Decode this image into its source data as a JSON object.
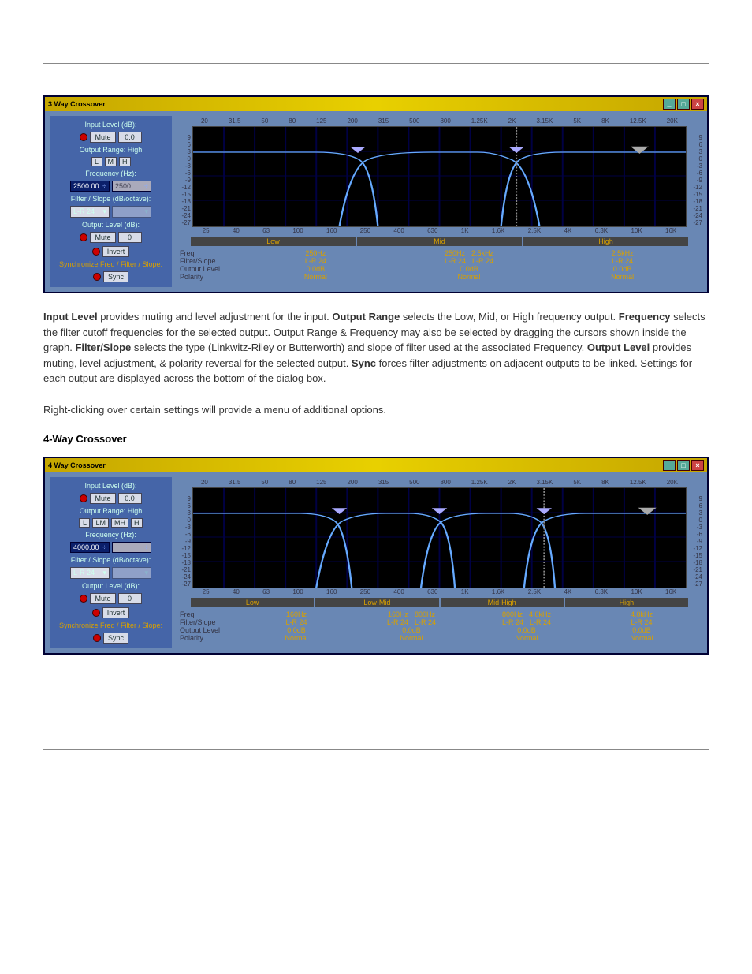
{
  "win3": {
    "title": "3 Way Crossover",
    "sidebar": {
      "input_label": "Input Level (dB):",
      "mute": "Mute",
      "val": "0.0",
      "range_label": "Output Range: High",
      "btns": [
        "L",
        "M",
        "H"
      ],
      "freq_label": "Frequency (Hz):",
      "freq_val": "2500.00",
      "freq_inact": "2500",
      "filt_label": "Filter / Slope (dB/octave):",
      "filt_val": "L-R 24",
      "out_label": "Output Level (dB):",
      "out_mute": "Mute",
      "out_val": "0",
      "invert": "Invert",
      "sync_label": "Synchronize Freq / Filter / Slope:",
      "sync": "Sync"
    },
    "ytop": [
      "20",
      "31.5",
      "50",
      "80",
      "125",
      "200",
      "315",
      "500",
      "800",
      "1.25K",
      "2K",
      "3.15K",
      "5K",
      "8K",
      "12.5K",
      "20K"
    ],
    "ybot": [
      "25",
      "40",
      "63",
      "100",
      "160",
      "250",
      "400",
      "630",
      "1K",
      "1.6K",
      "2.5K",
      "4K",
      "6.3K",
      "10K",
      "16K"
    ],
    "yl": [
      "9",
      "6",
      "3",
      "0",
      "-3",
      "-6",
      "-9",
      "-12",
      "-15",
      "-18",
      "-21",
      "-24",
      "-27"
    ],
    "yr": [
      "9",
      "6",
      "3",
      "0",
      "-3",
      "-6",
      "-9",
      "-12",
      "-15",
      "-18",
      "-21",
      "-24",
      "-27"
    ],
    "bands": [
      "Low",
      "Mid",
      "High"
    ],
    "summary": {
      "labels": [
        "Freq",
        "Filter/Slope",
        "Output Level",
        "Polarity"
      ],
      "cols": [
        {
          "freq": "250Hz",
          "filt": "L-R 24",
          "lvl": "0.0dB",
          "pol": "Normal"
        },
        {
          "freq_pair": [
            "250Hz",
            "2.5kHz"
          ],
          "filt_pair": [
            "L-R 24",
            "L-R 24"
          ],
          "lvl": "0.0dB",
          "pol": "Normal"
        },
        {
          "freq": "2.5kHz",
          "filt": "L-R 24",
          "lvl": "0.0dB",
          "pol": "Normal"
        }
      ]
    }
  },
  "win4": {
    "title": "4 Way Crossover",
    "sidebar": {
      "input_label": "Input Level (dB):",
      "mute": "Mute",
      "val": "0.0",
      "range_label": "Output Range: High",
      "btns": [
        "L",
        "LM",
        "MH",
        "H"
      ],
      "freq_label": "Frequency (Hz):",
      "freq_val": "4000.00",
      "freq_inact": "",
      "filt_label": "Filter / Slope (dB/octave):",
      "filt_val": "L-R 24",
      "out_label": "Output Level (dB):",
      "out_mute": "Mute",
      "out_val": "0",
      "invert": "Invert",
      "sync_label": "Synchronize Freq / Filter / Slope:",
      "sync": "Sync"
    },
    "bands": [
      "Low",
      "Low-Mid",
      "Mid-High",
      "High"
    ],
    "summary": {
      "labels": [
        "Freq",
        "Filter/Slope",
        "Output Level",
        "Polarity"
      ],
      "cols": [
        {
          "freq": "160Hz",
          "filt": "L-R 24",
          "lvl": "0.0dB",
          "pol": "Normal"
        },
        {
          "freq_pair": [
            "160Hz",
            "800Hz"
          ],
          "filt_pair": [
            "L-R 24",
            "L-R 24"
          ],
          "lvl": "0.0dB",
          "pol": "Normal"
        },
        {
          "freq_pair": [
            "800Hz",
            "4.0kHz"
          ],
          "filt_pair": [
            "L-R 24",
            "L-R 24"
          ],
          "lvl": "0.0dB",
          "pol": "Normal"
        },
        {
          "freq": "4.0kHz",
          "filt": "L-R 24",
          "lvl": "0.0dB",
          "pol": "Normal"
        }
      ]
    }
  },
  "para1": {
    "t1": "Input Level",
    "t2": " provides muting and level adjustment for the input. ",
    "t3": "Output Range",
    "t4": " selects the Low, Mid, or High frequency output. ",
    "t5": "Frequency",
    "t6": " selects the filter cutoff frequencies for the selected output. Output Range & Frequency may also be selected by dragging the cursors shown inside the graph. ",
    "t7": "Filter/Slope",
    "t8": " selects the type (Linkwitz-Riley or Butterworth) and slope of filter used at the associated Frequency. ",
    "t9": "Output Level",
    "t10": " provides muting, level adjustment, & polarity reversal for the selected output. ",
    "t11": "Sync",
    "t12": " forces filter adjustments on adjacent outputs to be linked. Settings for each output are displayed across the bottom of the dialog box."
  },
  "para2": "Right-clicking over certain settings will provide a menu of additional options.",
  "h3": "4-Way Crossover"
}
